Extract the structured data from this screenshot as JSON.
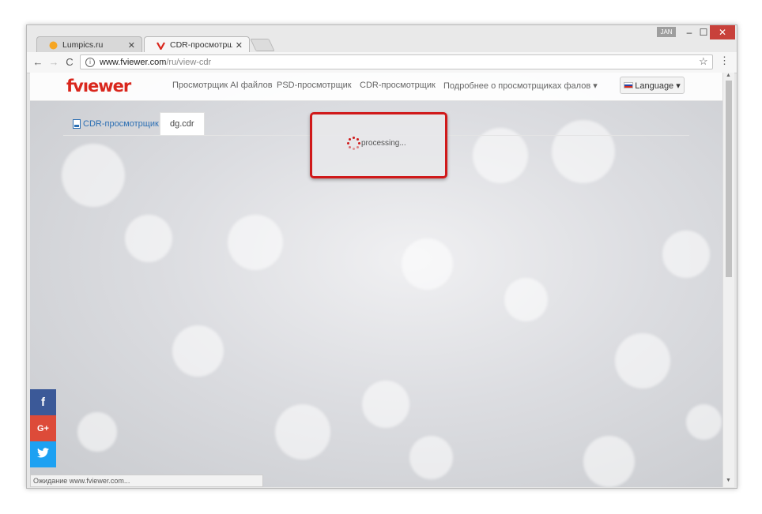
{
  "window": {
    "user_badge": "JAN",
    "minimize": "‒",
    "maximize": "☐",
    "close": "✕"
  },
  "tabs": [
    {
      "title": "Lumpics.ru",
      "close": "✕",
      "active": false
    },
    {
      "title": "CDR-просмотрщик -- C",
      "close": "✕",
      "active": true
    }
  ],
  "toolbar": {
    "back": "←",
    "forward": "→",
    "reload": "C",
    "url_host": "www.fviewer.com",
    "url_path": "/ru/view-cdr",
    "info": "i",
    "star": "☆",
    "menu": "⋮"
  },
  "site": {
    "logo": "fvıewer",
    "nav": [
      "Просмотрщик AI файлов",
      "PSD-просмотрщик",
      "CDR-просмотрщик",
      "Подробнее о просмотрщиках фалов ▾"
    ],
    "language": "Language ▾",
    "subtab_link": "CDR-просмотрщик",
    "subtab_file": "dg.cdr",
    "processing": "processing..."
  },
  "social": [
    {
      "label": "f",
      "color": "#3b5998"
    },
    {
      "label": "G+",
      "color": "#dd4b39"
    },
    {
      "label": "t",
      "color": "#1da1f2"
    }
  ],
  "status": "Ожидание www.fviewer.com...",
  "colors": {
    "accent": "#d9261c",
    "highlight": "#d0191a",
    "link": "#2c6fb3"
  }
}
